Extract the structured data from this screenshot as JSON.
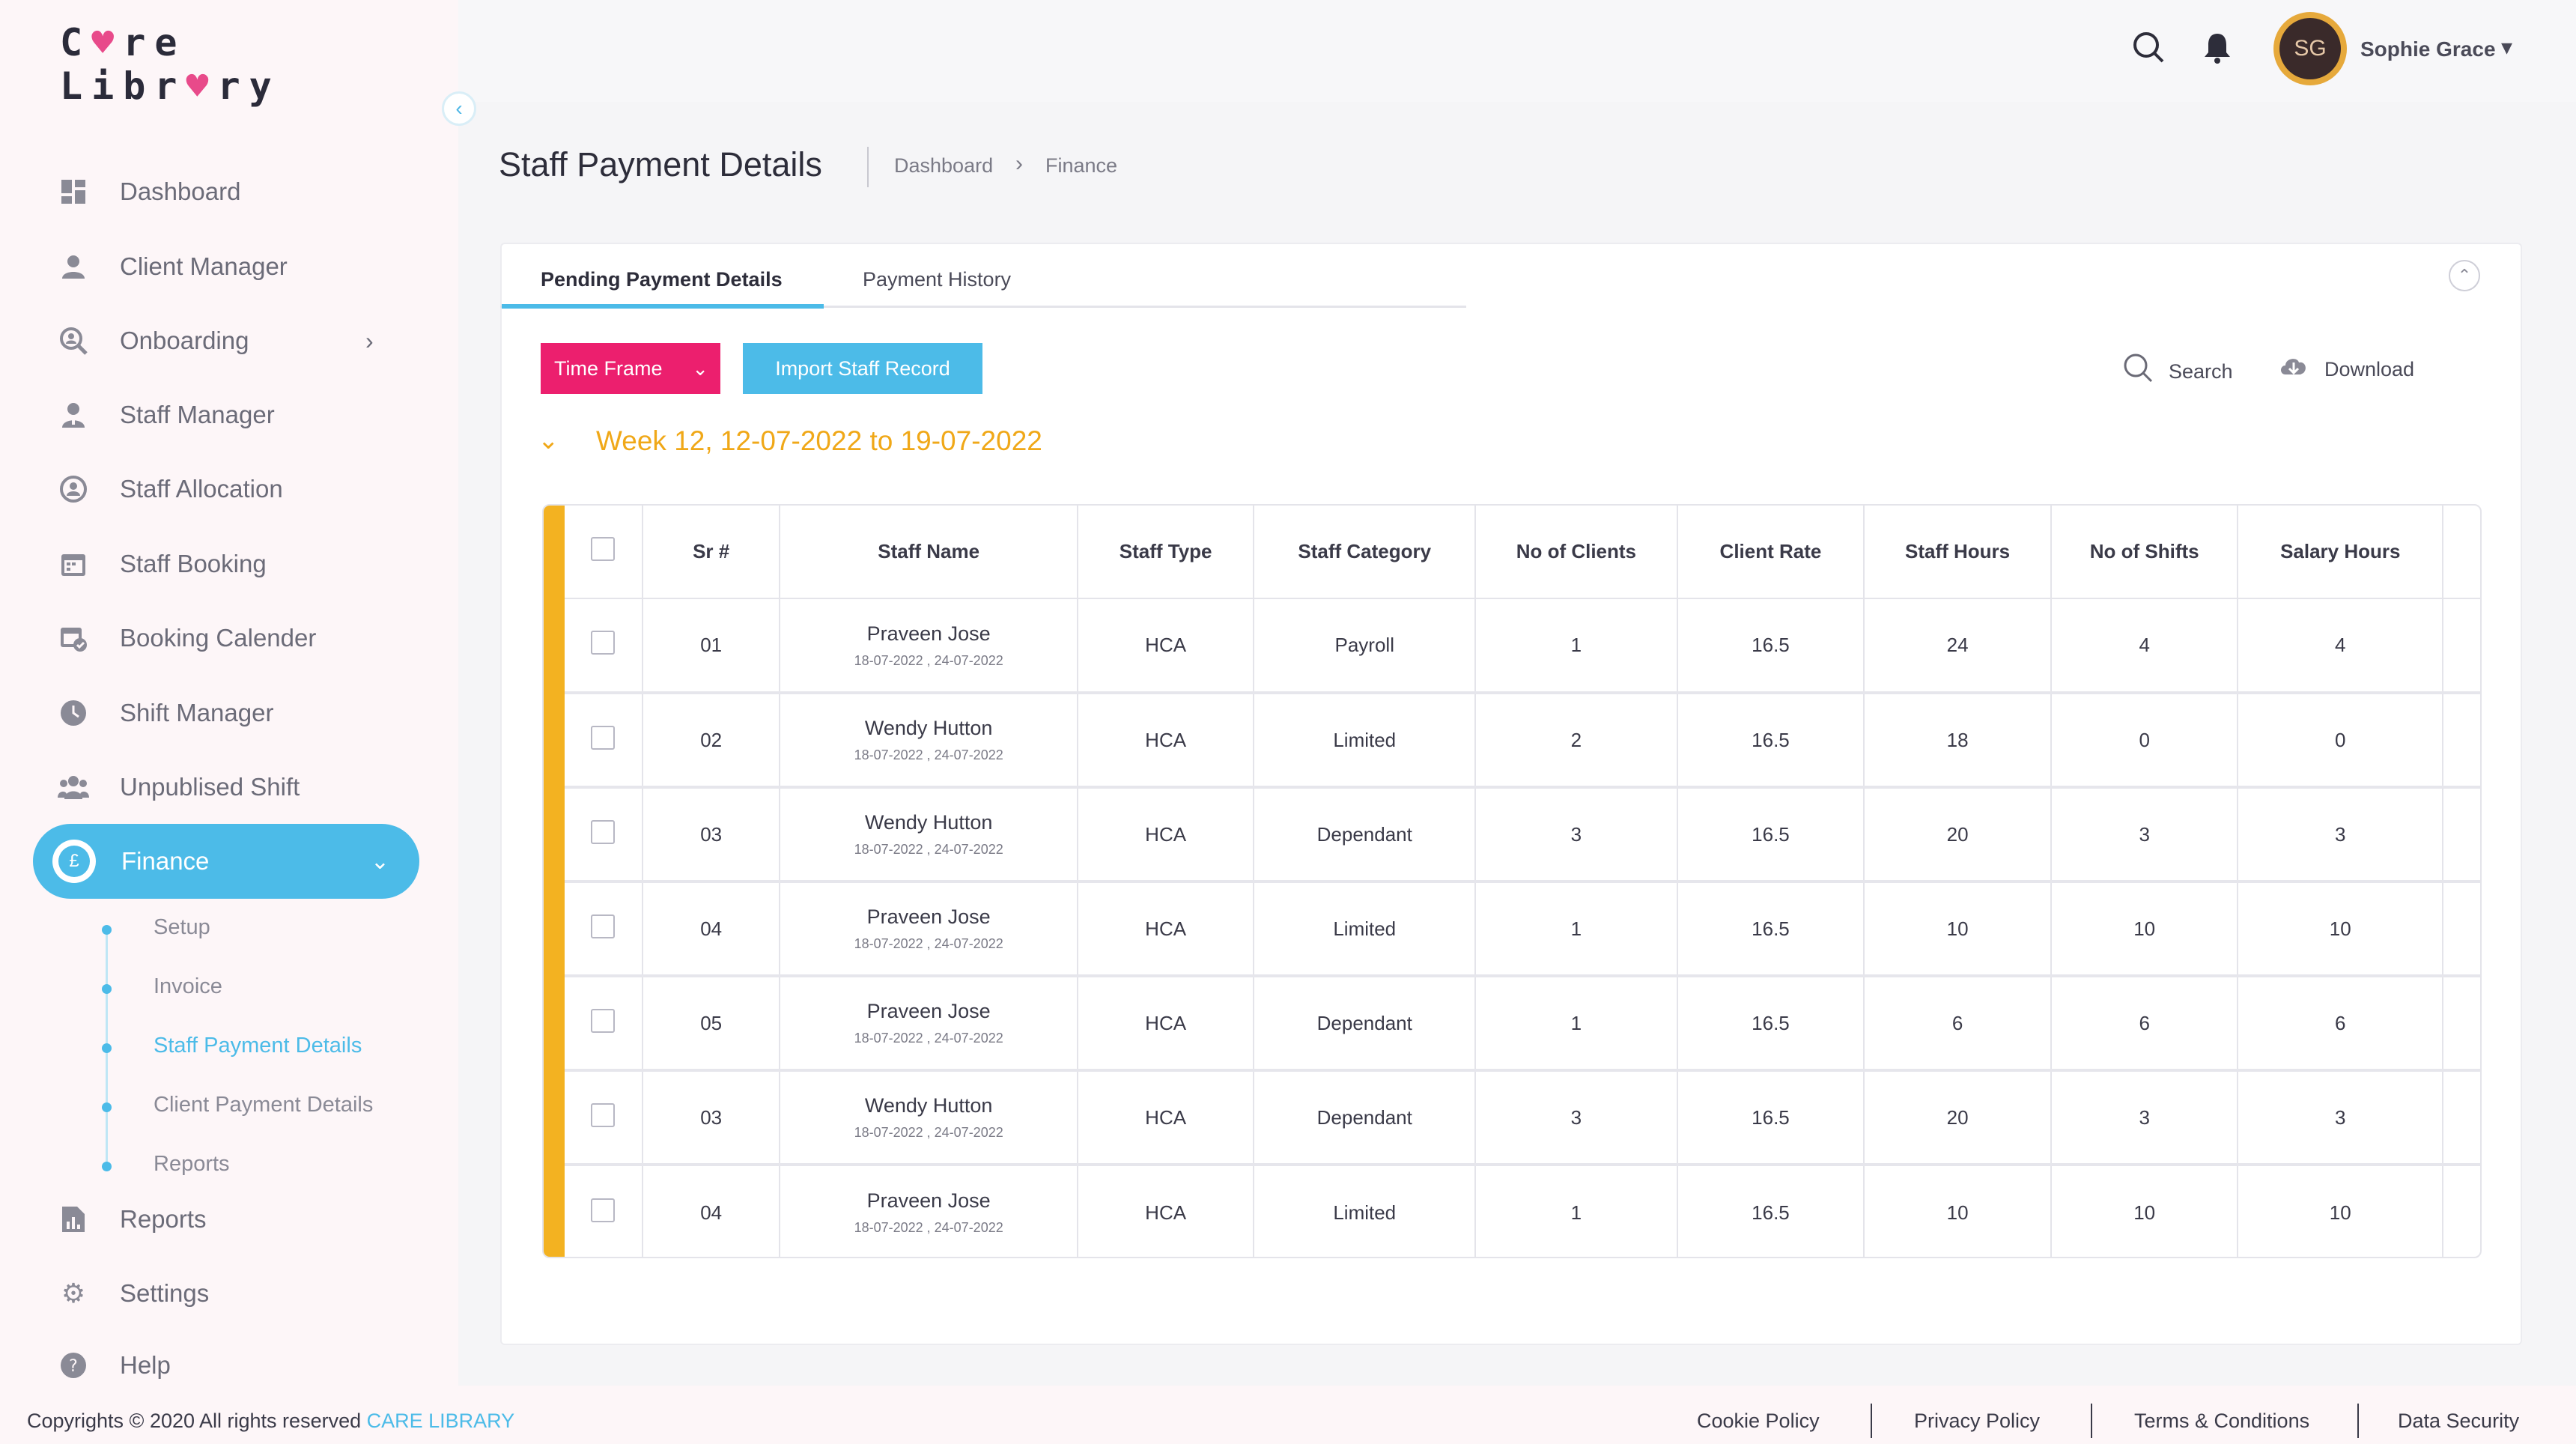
{
  "brand": {
    "logo_line1": "C",
    "logo_heart1": "♥",
    "logo_line1b": "re",
    "logo_line2a": "Libr",
    "logo_heart2": "♥",
    "logo_line2b": "ry"
  },
  "sidebar": {
    "items": [
      {
        "label": "Dashboard",
        "icon": "dashboard-icon"
      },
      {
        "label": "Client Manager",
        "icon": "user-icon"
      },
      {
        "label": "Onboarding",
        "icon": "search-user-icon"
      },
      {
        "label": "Staff Manager",
        "icon": "user-tie-icon"
      },
      {
        "label": "Staff Allocation",
        "icon": "allocation-icon"
      },
      {
        "label": "Staff Booking",
        "icon": "calendar-icon"
      },
      {
        "label": "Booking Calender",
        "icon": "calendar-check-icon"
      },
      {
        "label": "Shift Manager",
        "icon": "clock-icon"
      },
      {
        "label": "Unpublised Shift",
        "icon": "group-icon"
      }
    ],
    "active": {
      "label": "Finance",
      "icon_glyph": "£"
    },
    "sub_items": [
      "Setup",
      "Invoice",
      "Staff Payment Details",
      "Client Payment Details",
      "Reports"
    ],
    "bottom_items": [
      {
        "label": "Reports"
      },
      {
        "label": "Settings"
      },
      {
        "label": "Help"
      }
    ]
  },
  "header": {
    "user_name": "Sophie Grace",
    "avatar_initials": "SG"
  },
  "page": {
    "title": "Staff Payment Details",
    "breadcrumb": [
      "Dashboard",
      "Finance"
    ]
  },
  "tabs": [
    "Pending Payment Details",
    "Payment History"
  ],
  "toolbar": {
    "time_frame": "Time Frame",
    "import": "Import Staff Record",
    "search": "Search",
    "download": "Download"
  },
  "week_label": "Week 12, 12-07-2022 to 19-07-2022",
  "table": {
    "headers": [
      "Sr #",
      "Staff Name",
      "Staff Type",
      "Staff Category",
      "No of Clients",
      "Client Rate",
      "Staff Hours",
      "No of Shifts",
      "Salary Hours"
    ],
    "rows": [
      {
        "sr": "01",
        "name": "Praveen Jose",
        "dates": "18-07-2022 , 24-07-2022",
        "type": "HCA",
        "category": "Payroll",
        "clients": "1",
        "rate": "16.5",
        "hours": "24",
        "shifts": "4",
        "salary": "4"
      },
      {
        "sr": "02",
        "name": "Wendy Hutton",
        "dates": "18-07-2022 , 24-07-2022",
        "type": "HCA",
        "category": "Limited",
        "clients": "2",
        "rate": "16.5",
        "hours": "18",
        "shifts": "0",
        "salary": "0"
      },
      {
        "sr": "03",
        "name": "Wendy Hutton",
        "dates": "18-07-2022 , 24-07-2022",
        "type": "HCA",
        "category": "Dependant",
        "clients": "3",
        "rate": "16.5",
        "hours": "20",
        "shifts": "3",
        "salary": "3"
      },
      {
        "sr": "04",
        "name": "Praveen Jose",
        "dates": "18-07-2022 , 24-07-2022",
        "type": "HCA",
        "category": "Limited",
        "clients": "1",
        "rate": "16.5",
        "hours": "10",
        "shifts": "10",
        "salary": "10"
      },
      {
        "sr": "05",
        "name": "Praveen Jose",
        "dates": "18-07-2022 , 24-07-2022",
        "type": "HCA",
        "category": "Dependant",
        "clients": "1",
        "rate": "16.5",
        "hours": "6",
        "shifts": "6",
        "salary": "6"
      },
      {
        "sr": "03",
        "name": "Wendy Hutton",
        "dates": "18-07-2022 , 24-07-2022",
        "type": "HCA",
        "category": "Dependant",
        "clients": "3",
        "rate": "16.5",
        "hours": "20",
        "shifts": "3",
        "salary": "3"
      },
      {
        "sr": "04",
        "name": "Praveen Jose",
        "dates": "18-07-2022 , 24-07-2022",
        "type": "HCA",
        "category": "Limited",
        "clients": "1",
        "rate": "16.5",
        "hours": "10",
        "shifts": "10",
        "salary": "10"
      }
    ]
  },
  "footer": {
    "copyright": "Copyrights © 2020  All rights reserved",
    "brand": "CARE LIBRARY",
    "links": [
      "Cookie Policy",
      "Privacy Policy",
      "Terms & Conditions",
      "Data Security"
    ]
  },
  "colors": {
    "accent": "#4cbbe8",
    "pink": "#ec1f6e",
    "week": "#f0a818",
    "table_accent": "#f3b221"
  }
}
